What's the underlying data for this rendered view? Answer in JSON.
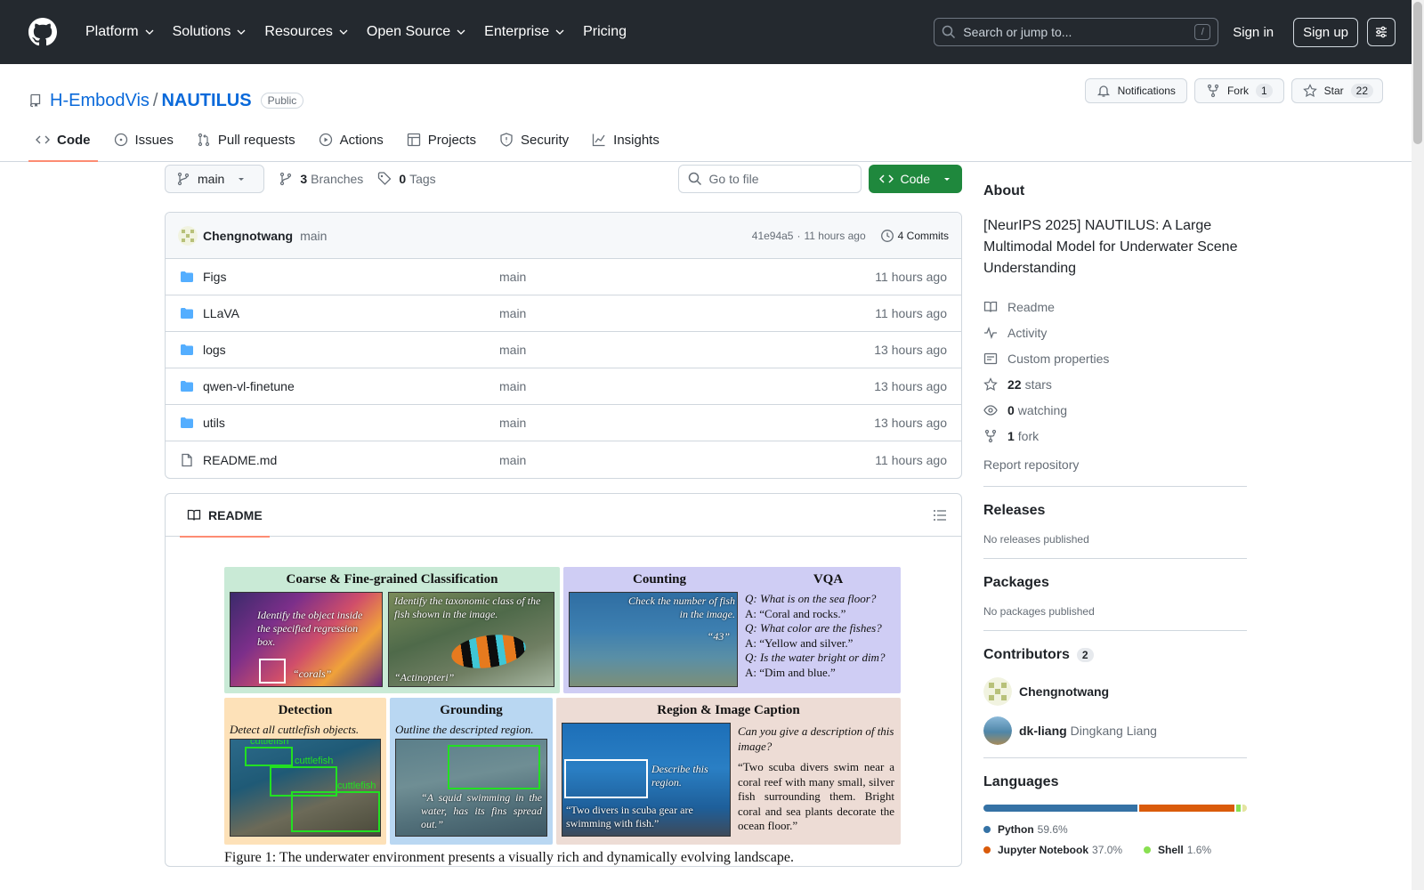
{
  "header": {
    "nav": [
      "Platform",
      "Solutions",
      "Resources",
      "Open Source",
      "Enterprise",
      "Pricing"
    ],
    "search_placeholder": "Search or jump to...",
    "search_shortcut": "/",
    "signin": "Sign in",
    "signup": "Sign up"
  },
  "repo": {
    "owner": "H-EmbodVis",
    "separator": "/",
    "name": "NAUTILUS",
    "visibility": "Public",
    "notifications_label": "Notifications",
    "fork_label": "Fork",
    "fork_count": "1",
    "star_label": "Star",
    "star_count": "22"
  },
  "tabs": [
    "Code",
    "Issues",
    "Pull requests",
    "Actions",
    "Projects",
    "Security",
    "Insights"
  ],
  "toolbar": {
    "branch": "main",
    "branches_count": "3",
    "branches_label": "Branches",
    "tags_count": "0",
    "tags_label": "Tags",
    "goto_placeholder": "Go to file",
    "code_label": "Code"
  },
  "commit": {
    "author": "Chengnotwang",
    "message": "main",
    "hash": "41e94a5",
    "meta_sep": "·",
    "time": "11 hours ago",
    "commits_label": "4 Commits"
  },
  "files": [
    {
      "name": "Figs",
      "type": "dir",
      "message": "main",
      "time": "11 hours ago"
    },
    {
      "name": "LLaVA",
      "type": "dir",
      "message": "main",
      "time": "11 hours ago"
    },
    {
      "name": "logs",
      "type": "dir",
      "message": "main",
      "time": "13 hours ago"
    },
    {
      "name": "qwen-vl-finetune",
      "type": "dir",
      "message": "main",
      "time": "13 hours ago"
    },
    {
      "name": "utils",
      "type": "dir",
      "message": "main",
      "time": "13 hours ago"
    },
    {
      "name": "README.md",
      "type": "file",
      "message": "main",
      "time": "11 hours ago"
    }
  ],
  "readme": {
    "tab_label": "README",
    "figure": {
      "classification_title": "Coarse & Fine-grained Classification",
      "cls_text1": "Identify the object inside the specified regression box.",
      "cls_ans1": "“corals”",
      "cls_text2": "Identify the taxonomic class of the fish shown in the image.",
      "cls_ans2": "“Actinopteri”",
      "counting_title": "Counting",
      "count_text": "Check the number of fish in the image.",
      "count_ans": "“43”",
      "vqa_title": "VQA",
      "vqa_lines": [
        "Q: What is on the sea floor?",
        "A: “Coral and rocks.”",
        "Q: What color are the fishes?",
        "A: “Yellow and silver.”",
        "Q: Is the water bright or dim?",
        "A: “Dim and blue.”"
      ],
      "detection_title": "Detection",
      "det_text": "Detect all cuttlefish objects.",
      "det_label": "cuttlefish",
      "grounding_title": "Grounding",
      "gr_text": "Outline the descripted region.",
      "gr_cap": "“A squid swimming in the water, has its fins spread out.”",
      "caption_title": "Region & Image Caption",
      "cap_q": "Can you give a description of this image?",
      "cap_a": "“Two scuba divers swim near a coral reef with many small, silver fish surrounding them. Bright coral and sea plants decorate the ocean floor.”",
      "cap_region": "Describe this region.",
      "cap_region_ans": "“Two divers in scuba gear are swimming with fish.”"
    },
    "caption": "Figure 1: The underwater environment presents a visually rich and dynamically evolving landscape."
  },
  "sidebar": {
    "about_title": "About",
    "description": "[NeurIPS 2025] NAUTILUS: A Large Multimodal Model for Underwater Scene Understanding",
    "readme": "Readme",
    "activity": "Activity",
    "custom_properties": "Custom properties",
    "stars_count": "22",
    "stars_label": "stars",
    "watching_count": "0",
    "watching_label": "watching",
    "fork_count": "1",
    "fork_label": "fork",
    "report": "Report repository",
    "releases_title": "Releases",
    "releases_sub": "No releases published",
    "packages_title": "Packages",
    "packages_sub": "No packages published",
    "contributors_title": "Contributors",
    "contributors_count": "2",
    "contributors": [
      {
        "login": "Chengnotwang",
        "name": ""
      },
      {
        "login": "dk-liang",
        "name": "Dingkang Liang"
      }
    ],
    "languages_title": "Languages",
    "languages": [
      {
        "name": "Python",
        "pct": "59.6%",
        "value": 59.6,
        "color": "#3572A5"
      },
      {
        "name": "Jupyter Notebook",
        "pct": "37.0%",
        "value": 37.0,
        "color": "#DA5B0B"
      },
      {
        "name": "Shell",
        "pct": "1.6%",
        "value": 1.6,
        "color": "#89e051"
      },
      {
        "name": "",
        "pct": "",
        "value": 1.8,
        "color": "#e4e4a0"
      }
    ]
  }
}
